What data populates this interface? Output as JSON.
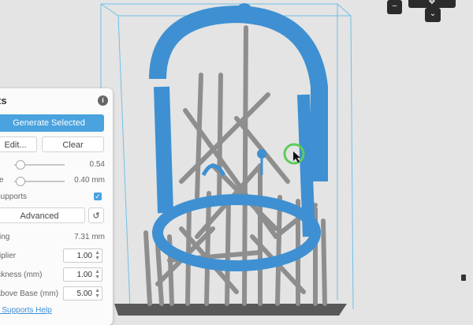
{
  "panel": {
    "title": "rts",
    "info_icon": "i",
    "generate_label": "Generate Selected",
    "edit_label": "Edit...",
    "clear_label": "Clear",
    "density_value": "0.54",
    "size_label": "ze",
    "size_value": "0.40 mm",
    "supports_label": "Supports",
    "advanced_label": "Advanced",
    "reset_icon": "↺",
    "spacing_label": "cing",
    "spacing_value": "7.31 mm",
    "multiplier_label": "ltiplier",
    "multiplier_value": "1.00",
    "thickness_label": "ickness (mm)",
    "thickness_value": "1.00",
    "above_base_label": "Above Base (mm)",
    "above_base_value": "5.00",
    "help_link": "d Supports Help",
    "colors": {
      "accent": "#4aa2de",
      "model": "#3f8fd0",
      "supports": "#8a8a8a"
    }
  },
  "nav": {
    "zoom_out": "–",
    "rotate": "✥",
    "down": "⌄"
  }
}
